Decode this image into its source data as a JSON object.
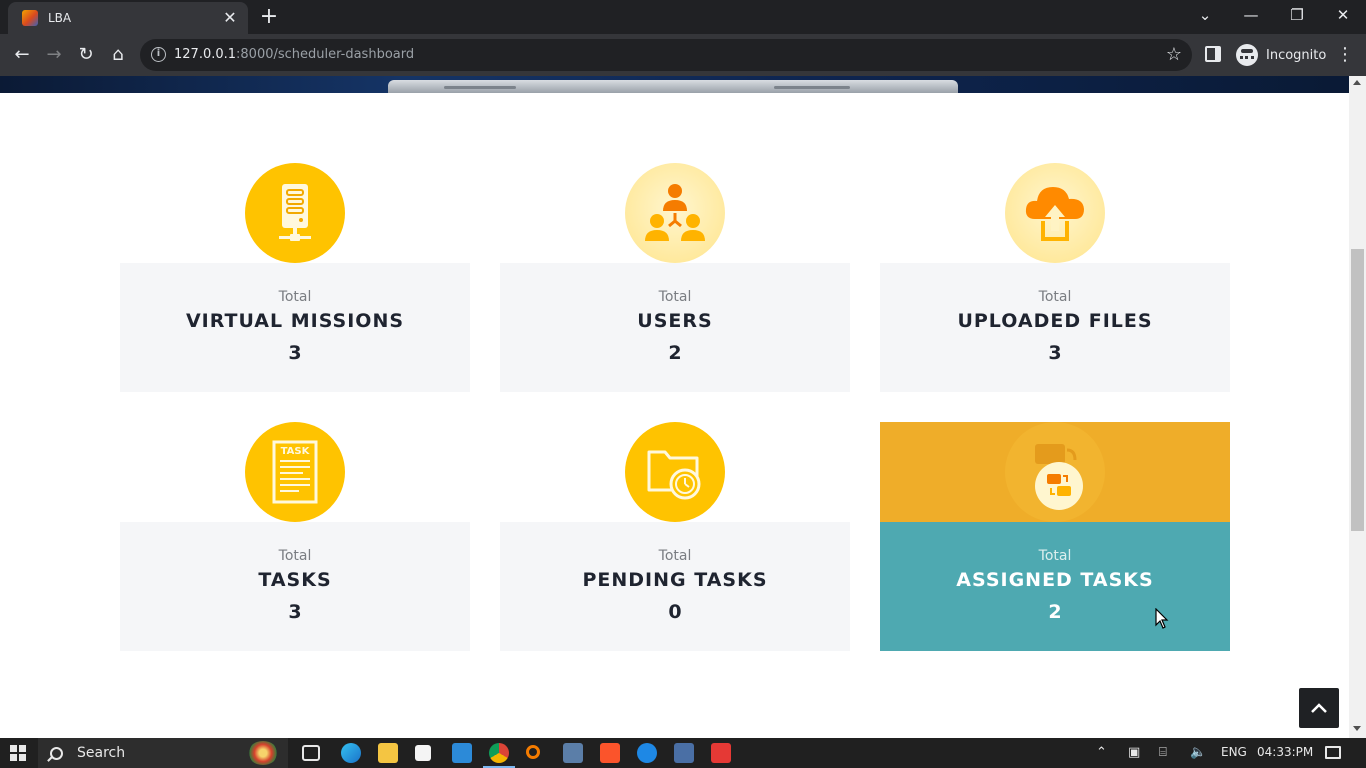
{
  "browser": {
    "tab_title": "LBA",
    "url_host": "127.0.0.1",
    "url_rest": ":8000/scheduler-dashboard",
    "profile_label": "Incognito"
  },
  "colors": {
    "card_bg": "#f5f6f8",
    "icon_gold": "#ffc300",
    "active_top": "#efad29",
    "active_body": "#4ea9b1"
  },
  "cards": [
    {
      "kicker": "Total",
      "title": "VIRTUAL MISSIONS",
      "value": "3",
      "icon": "server-icon"
    },
    {
      "kicker": "Total",
      "title": "USERS",
      "value": "2",
      "icon": "users-network-icon"
    },
    {
      "kicker": "Total",
      "title": "UPLOADED FILES",
      "value": "3",
      "icon": "cloud-upload-icon"
    },
    {
      "kicker": "Total",
      "title": "TASKS",
      "value": "3",
      "icon": "task-document-icon",
      "icon_text": "TASK"
    },
    {
      "kicker": "Total",
      "title": "PENDING TASKS",
      "value": "0",
      "icon": "folder-clock-icon"
    },
    {
      "kicker": "Total",
      "title": "ASSIGNED TASKS",
      "value": "2",
      "icon": "assign-transfer-icon"
    }
  ],
  "taskbar": {
    "search_label": "Search",
    "language": "ENG",
    "time": "04:33:PM"
  }
}
